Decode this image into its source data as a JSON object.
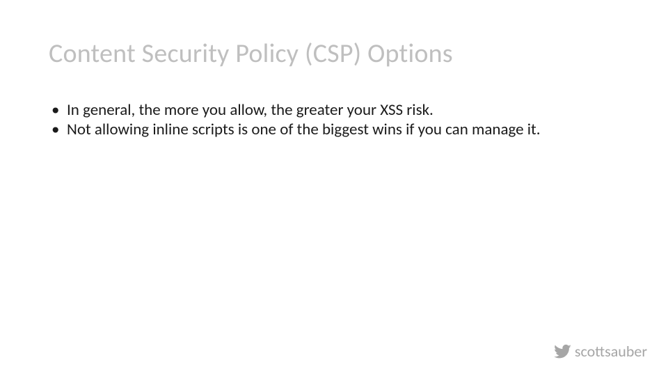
{
  "title": "Content Security Policy (CSP) Options",
  "bullets": [
    "In general, the more you allow, the greater your XSS risk.",
    "Not allowing inline scripts is one of the biggest wins if you can manage it."
  ],
  "footer": {
    "handle": "scottsauber",
    "icon_name": "twitter-icon",
    "icon_color": "#a6a6a6"
  }
}
